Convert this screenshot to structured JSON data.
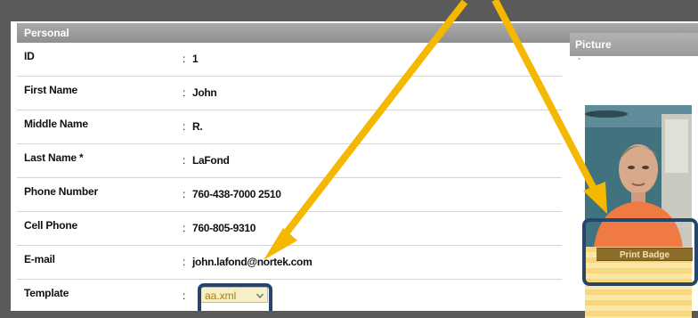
{
  "personal": {
    "header": "Personal",
    "fields": [
      {
        "label": "ID",
        "colon": ":",
        "value": "1"
      },
      {
        "label": "First Name",
        "colon": ":",
        "value": "John"
      },
      {
        "label": "Middle Name",
        "colon": ":",
        "value": "R."
      },
      {
        "label": "Last Name *",
        "colon": ":",
        "value": "LaFond"
      },
      {
        "label": "Phone Number",
        "colon": ":",
        "value": "760-438-7000 2510"
      },
      {
        "label": "Cell Phone",
        "colon": ":",
        "value": "760-805-9310"
      },
      {
        "label": "E-mail",
        "colon": ":",
        "value": "john.lafond@nortek.com"
      },
      {
        "label": "Template",
        "colon": ":",
        "value": ""
      }
    ],
    "template_select": {
      "selected": "aa.xml",
      "icon": "chevron-down-icon"
    }
  },
  "picture": {
    "header": "Picture",
    "tick": "`",
    "print_badge_label": "Print Badge"
  },
  "colors": {
    "header_gray": "#9a9a9a",
    "highlight_border": "#25456b",
    "arrow": "#f5b800",
    "badge_button": "#8d6d28",
    "badge_stripe": "#f8d77c"
  }
}
